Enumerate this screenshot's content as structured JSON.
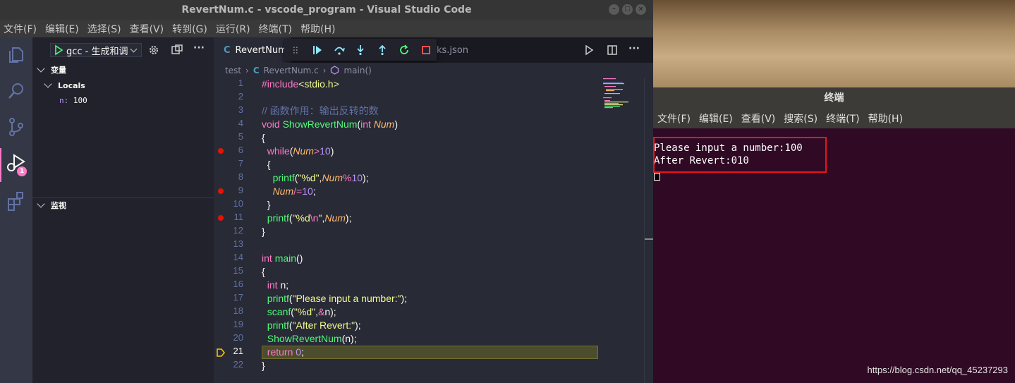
{
  "vscode": {
    "window_title": "RevertNum.c - vscode_program - Visual Studio Code",
    "menu": [
      "文件(F)",
      "编辑(E)",
      "选择(S)",
      "查看(V)",
      "转到(G)",
      "运行(R)",
      "终端(T)",
      "帮助(H)"
    ],
    "debug_badge": "1",
    "run_config": "gcc - 生成和调",
    "sections": {
      "variables": "变量",
      "locals": "Locals",
      "watch": "监视"
    },
    "locals_var": {
      "name": "n:",
      "value": "100"
    },
    "tabs": [
      {
        "icon": "C",
        "label": "RevertNum"
      },
      {
        "label": "ks.json"
      }
    ],
    "breadcrumb": [
      "test",
      "C",
      "RevertNum.c",
      "main()"
    ],
    "line_numbers": [
      "1",
      "2",
      "3",
      "4",
      "5",
      "6",
      "7",
      "8",
      "9",
      "10",
      "11",
      "12",
      "13",
      "14",
      "15",
      "16",
      "17",
      "18",
      "19",
      "20",
      "21",
      "22"
    ],
    "code": [
      [
        [
          "kw",
          "#include"
        ],
        [
          "str",
          "<stdio.h>"
        ]
      ],
      [],
      [
        [
          "cm",
          "// 函数作用：输出反转的数"
        ]
      ],
      [
        [
          "kw",
          "void "
        ],
        [
          "fn",
          "ShowRevertNum"
        ],
        [
          "pl",
          "("
        ],
        [
          "kw",
          "int "
        ],
        [
          "prm",
          "Num"
        ],
        [
          "pl",
          ")"
        ]
      ],
      [
        [
          "pl",
          "{"
        ]
      ],
      [
        [
          "pl",
          "  "
        ],
        [
          "kw",
          "while"
        ],
        [
          "pl",
          "("
        ],
        [
          "prm",
          "Num"
        ],
        [
          "kw",
          ">"
        ],
        [
          "num",
          "10"
        ],
        [
          "pl",
          ")"
        ]
      ],
      [
        [
          "pl",
          "  {"
        ]
      ],
      [
        [
          "pl",
          "    "
        ],
        [
          "fn",
          "printf"
        ],
        [
          "pl",
          "("
        ],
        [
          "str",
          "\"%d\""
        ],
        [
          "pl",
          ","
        ],
        [
          "prm",
          "Num"
        ],
        [
          "kw",
          "%"
        ],
        [
          "num",
          "10"
        ],
        [
          "pl",
          ");"
        ]
      ],
      [
        [
          "pl",
          "    "
        ],
        [
          "prm",
          "Num"
        ],
        [
          "kw",
          "/="
        ],
        [
          "num",
          "10"
        ],
        [
          "pl",
          ";"
        ]
      ],
      [
        [
          "pl",
          "  }"
        ]
      ],
      [
        [
          "pl",
          "  "
        ],
        [
          "fn",
          "printf"
        ],
        [
          "pl",
          "("
        ],
        [
          "str",
          "\"%d"
        ],
        [
          "esc",
          "\\n"
        ],
        [
          "str",
          "\""
        ],
        [
          "pl",
          ","
        ],
        [
          "prm",
          "Num"
        ],
        [
          "pl",
          ");"
        ]
      ],
      [
        [
          "pl",
          "}"
        ]
      ],
      [],
      [
        [
          "kw",
          "int "
        ],
        [
          "fn",
          "main"
        ],
        [
          "pl",
          "()"
        ]
      ],
      [
        [
          "pl",
          "{"
        ]
      ],
      [
        [
          "pl",
          "  "
        ],
        [
          "kw",
          "int "
        ],
        [
          "pl",
          "n;"
        ]
      ],
      [
        [
          "pl",
          "  "
        ],
        [
          "fn",
          "printf"
        ],
        [
          "pl",
          "("
        ],
        [
          "str",
          "\"Please input a number:\""
        ],
        [
          "pl",
          ");"
        ]
      ],
      [
        [
          "pl",
          "  "
        ],
        [
          "fn",
          "scanf"
        ],
        [
          "pl",
          "("
        ],
        [
          "str",
          "\"%d\""
        ],
        [
          "pl",
          ","
        ],
        [
          "kw",
          "&"
        ],
        [
          "pl",
          "n);"
        ]
      ],
      [
        [
          "pl",
          "  "
        ],
        [
          "fn",
          "printf"
        ],
        [
          "pl",
          "("
        ],
        [
          "str",
          "\"After Revert:\""
        ],
        [
          "pl",
          ");"
        ]
      ],
      [
        [
          "pl",
          "  "
        ],
        [
          "fn",
          "ShowRevertNum"
        ],
        [
          "pl",
          "(n);"
        ]
      ],
      [
        [
          "pl",
          "  "
        ],
        [
          "kw",
          "return "
        ],
        [
          "num",
          "0"
        ],
        [
          "pl",
          ";"
        ]
      ],
      [
        [
          "pl",
          "}"
        ]
      ]
    ],
    "breakpoint_lines": [
      6,
      9,
      11
    ],
    "current_line": 21,
    "colors": {
      "accent": "#ff79c6",
      "breakpoint": "#e51400",
      "current_line": "#4c4d2d"
    }
  },
  "terminal": {
    "title": "终端",
    "menu": [
      "文件(F)",
      "编辑(E)",
      "查看(V)",
      "搜索(S)",
      "终端(T)",
      "帮助(H)"
    ],
    "lines": [
      "Please input a number:100",
      "After Revert:010"
    ],
    "highlight_color": "#e8141c"
  },
  "watermark": "https://blog.csdn.net/qq_45237293"
}
